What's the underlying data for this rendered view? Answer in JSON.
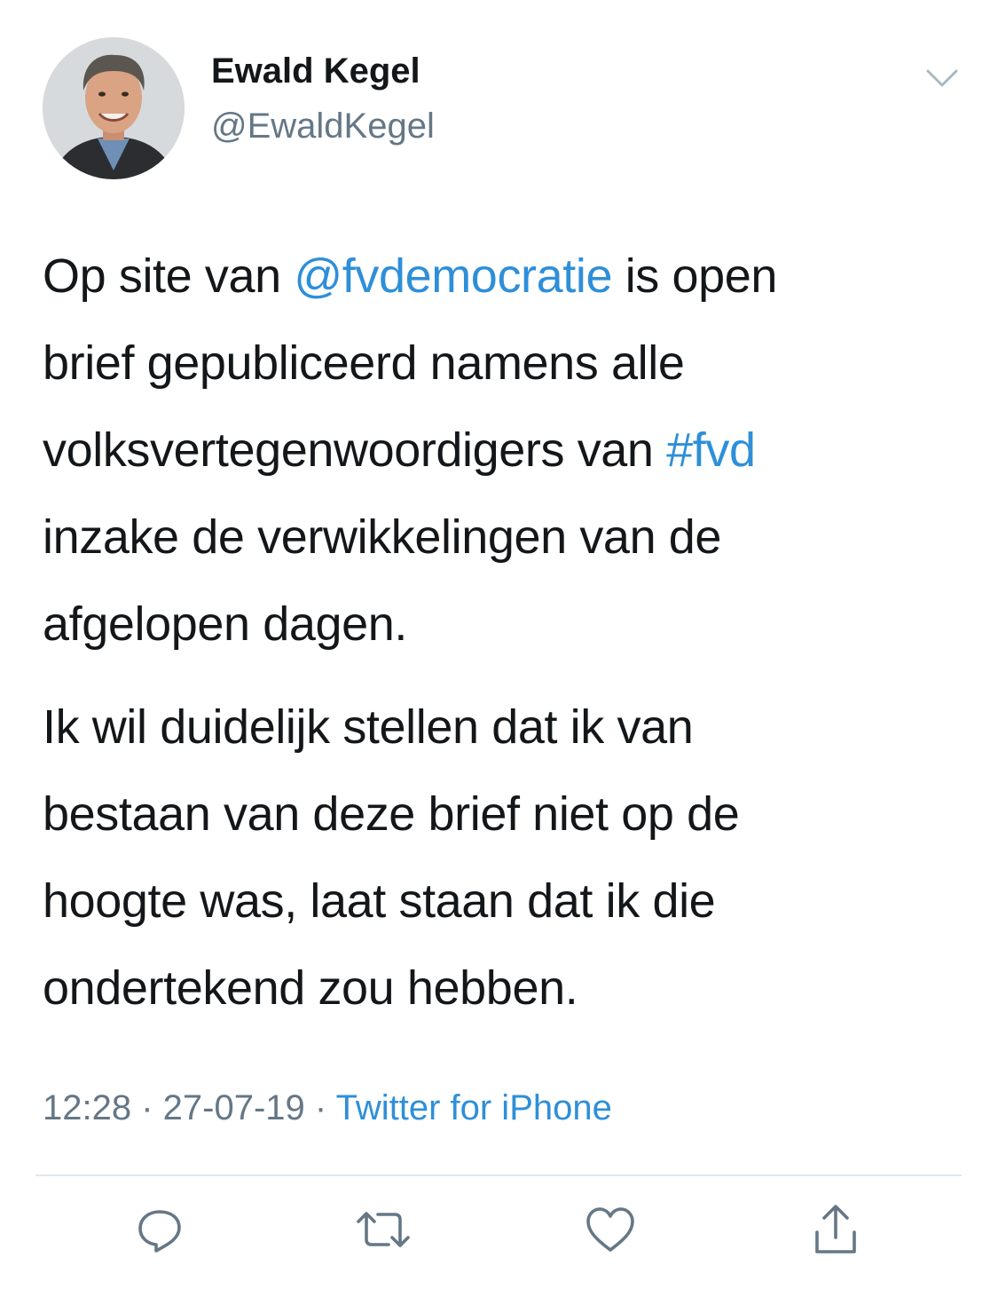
{
  "author": {
    "display_name": "Ewald Kegel",
    "handle": "@EwaldKegel"
  },
  "tweet": {
    "paragraphs": [
      [
        [
          {
            "t": "Op site van "
          },
          {
            "t": "@fvdemocratie",
            "link": true
          },
          {
            "t": " is open"
          }
        ],
        [
          {
            "t": "brief gepubliceerd namens alle"
          }
        ],
        [
          {
            "t": "volksvertegenwoordigers van "
          },
          {
            "t": "#fvd",
            "link": true
          }
        ],
        [
          {
            "t": "inzake de verwikkelingen van de"
          }
        ],
        [
          {
            "t": "afgelopen dagen."
          }
        ]
      ],
      [
        [
          {
            "t": "Ik wil duidelijk stellen dat ik van"
          }
        ],
        [
          {
            "t": "bestaan van deze brief niet op de"
          }
        ],
        [
          {
            "t": "hoogte was, laat staan dat ik die"
          }
        ],
        [
          {
            "t": "ondertekend zou hebben."
          }
        ]
      ]
    ]
  },
  "meta": {
    "time": "12:28",
    "separator": " · ",
    "date": "27-07-19",
    "source": "Twitter for iPhone"
  },
  "icons": {
    "caret": "chevron-down-icon",
    "reply": "reply-icon",
    "retweet": "retweet-icon",
    "like": "heart-icon",
    "share": "share-icon"
  },
  "colors": {
    "link": "#2e8fd9",
    "text": "#14171a",
    "secondary": "#657786",
    "divider": "#e1e8ed"
  }
}
